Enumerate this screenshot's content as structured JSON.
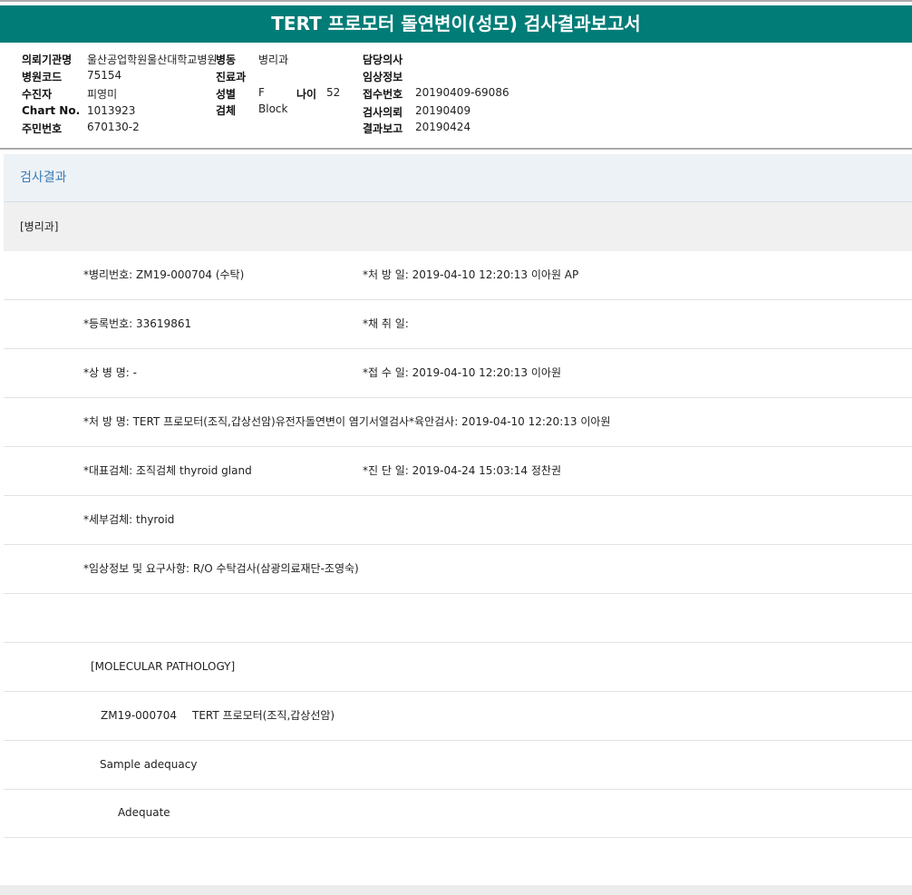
{
  "title": "TERT 프로모터 돌연변이(성모) 검사결과보고서",
  "info": {
    "institution_label": "의뢰기관명",
    "institution": "울산공업학원울산대학교병원",
    "ward_label": "병동",
    "ward": "병리과",
    "doctor_label": "담당의사",
    "doctor": "",
    "hospital_code_label": "병원코드",
    "hospital_code": "75154",
    "dept_label": "진료과",
    "dept": "",
    "clinical_label": "임상정보",
    "clinical": "",
    "patient_label": "수진자",
    "patient": "피영미",
    "sex_label": "성별",
    "sex": "F",
    "age_label": "나이",
    "age": "52",
    "reception_label": "접수번호",
    "reception": "20190409-69086",
    "chart_label": "Chart No.",
    "chart": "1013923",
    "specimen_label": "검체",
    "specimen": "Block",
    "request_label": "검사의뢰",
    "request": "20190409",
    "id_label": "주민번호",
    "id": "670130-2",
    "report_label": "결과보고",
    "report": "20190424"
  },
  "section": "검사결과",
  "dept_header": "[병리과]",
  "rows": [
    {
      "a": "*병리번호: ZM19-000704 (수탁)",
      "b": "*처 방 일: 2019-04-10 12:20:13  이아원 AP"
    },
    {
      "a": "*등록번호: 33619861",
      "b": "*채 취 일:"
    },
    {
      "a": "*상 병 명: -",
      "b": "*접 수 일: 2019-04-10 12:20:13  이아원"
    },
    {
      "a": "*처 방 명: TERT 프로모터(조직,갑상선암)유전자돌연변이 염기서열검사*육안검사: 2019-04-10 12:20:13  이아원",
      "b": ""
    },
    {
      "a": "*대표검체: 조직검체 thyroid gland",
      "b": "*진 단 일: 2019-04-24 15:03:14  정찬권"
    },
    {
      "a": "*세부검체: thyroid",
      "b": ""
    },
    {
      "a": "*임상정보 및 요구사항: R/O 수탁검사(삼광의료재단-조영숙)",
      "b": ""
    }
  ],
  "results": {
    "heading": "[MOLECULAR PATHOLOGY]",
    "test_id": "ZM19-000704",
    "test_name": "TERT 프로모터(조직,갑상선암)",
    "adequacy_label": "Sample adequacy",
    "adequacy_value": "Adequate"
  }
}
